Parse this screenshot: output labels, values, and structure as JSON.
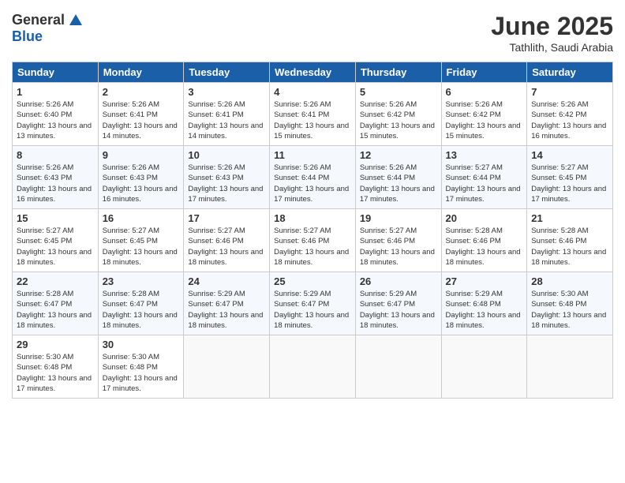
{
  "logo": {
    "general": "General",
    "blue": "Blue"
  },
  "title": "June 2025",
  "location": "Tathlith, Saudi Arabia",
  "weekdays": [
    "Sunday",
    "Monday",
    "Tuesday",
    "Wednesday",
    "Thursday",
    "Friday",
    "Saturday"
  ],
  "weeks": [
    [
      {
        "day": "1",
        "sunrise": "5:26 AM",
        "sunset": "6:40 PM",
        "daylight": "13 hours and 13 minutes."
      },
      {
        "day": "2",
        "sunrise": "5:26 AM",
        "sunset": "6:41 PM",
        "daylight": "13 hours and 14 minutes."
      },
      {
        "day": "3",
        "sunrise": "5:26 AM",
        "sunset": "6:41 PM",
        "daylight": "13 hours and 14 minutes."
      },
      {
        "day": "4",
        "sunrise": "5:26 AM",
        "sunset": "6:41 PM",
        "daylight": "13 hours and 15 minutes."
      },
      {
        "day": "5",
        "sunrise": "5:26 AM",
        "sunset": "6:42 PM",
        "daylight": "13 hours and 15 minutes."
      },
      {
        "day": "6",
        "sunrise": "5:26 AM",
        "sunset": "6:42 PM",
        "daylight": "13 hours and 15 minutes."
      },
      {
        "day": "7",
        "sunrise": "5:26 AM",
        "sunset": "6:42 PM",
        "daylight": "13 hours and 16 minutes."
      }
    ],
    [
      {
        "day": "8",
        "sunrise": "5:26 AM",
        "sunset": "6:43 PM",
        "daylight": "13 hours and 16 minutes."
      },
      {
        "day": "9",
        "sunrise": "5:26 AM",
        "sunset": "6:43 PM",
        "daylight": "13 hours and 16 minutes."
      },
      {
        "day": "10",
        "sunrise": "5:26 AM",
        "sunset": "6:43 PM",
        "daylight": "13 hours and 17 minutes."
      },
      {
        "day": "11",
        "sunrise": "5:26 AM",
        "sunset": "6:44 PM",
        "daylight": "13 hours and 17 minutes."
      },
      {
        "day": "12",
        "sunrise": "5:26 AM",
        "sunset": "6:44 PM",
        "daylight": "13 hours and 17 minutes."
      },
      {
        "day": "13",
        "sunrise": "5:27 AM",
        "sunset": "6:44 PM",
        "daylight": "13 hours and 17 minutes."
      },
      {
        "day": "14",
        "sunrise": "5:27 AM",
        "sunset": "6:45 PM",
        "daylight": "13 hours and 17 minutes."
      }
    ],
    [
      {
        "day": "15",
        "sunrise": "5:27 AM",
        "sunset": "6:45 PM",
        "daylight": "13 hours and 18 minutes."
      },
      {
        "day": "16",
        "sunrise": "5:27 AM",
        "sunset": "6:45 PM",
        "daylight": "13 hours and 18 minutes."
      },
      {
        "day": "17",
        "sunrise": "5:27 AM",
        "sunset": "6:46 PM",
        "daylight": "13 hours and 18 minutes."
      },
      {
        "day": "18",
        "sunrise": "5:27 AM",
        "sunset": "6:46 PM",
        "daylight": "13 hours and 18 minutes."
      },
      {
        "day": "19",
        "sunrise": "5:27 AM",
        "sunset": "6:46 PM",
        "daylight": "13 hours and 18 minutes."
      },
      {
        "day": "20",
        "sunrise": "5:28 AM",
        "sunset": "6:46 PM",
        "daylight": "13 hours and 18 minutes."
      },
      {
        "day": "21",
        "sunrise": "5:28 AM",
        "sunset": "6:46 PM",
        "daylight": "13 hours and 18 minutes."
      }
    ],
    [
      {
        "day": "22",
        "sunrise": "5:28 AM",
        "sunset": "6:47 PM",
        "daylight": "13 hours and 18 minutes."
      },
      {
        "day": "23",
        "sunrise": "5:28 AM",
        "sunset": "6:47 PM",
        "daylight": "13 hours and 18 minutes."
      },
      {
        "day": "24",
        "sunrise": "5:29 AM",
        "sunset": "6:47 PM",
        "daylight": "13 hours and 18 minutes."
      },
      {
        "day": "25",
        "sunrise": "5:29 AM",
        "sunset": "6:47 PM",
        "daylight": "13 hours and 18 minutes."
      },
      {
        "day": "26",
        "sunrise": "5:29 AM",
        "sunset": "6:47 PM",
        "daylight": "13 hours and 18 minutes."
      },
      {
        "day": "27",
        "sunrise": "5:29 AM",
        "sunset": "6:48 PM",
        "daylight": "13 hours and 18 minutes."
      },
      {
        "day": "28",
        "sunrise": "5:30 AM",
        "sunset": "6:48 PM",
        "daylight": "13 hours and 18 minutes."
      }
    ],
    [
      {
        "day": "29",
        "sunrise": "5:30 AM",
        "sunset": "6:48 PM",
        "daylight": "13 hours and 17 minutes."
      },
      {
        "day": "30",
        "sunrise": "5:30 AM",
        "sunset": "6:48 PM",
        "daylight": "13 hours and 17 minutes."
      },
      null,
      null,
      null,
      null,
      null
    ]
  ],
  "labels": {
    "sunrise": "Sunrise:",
    "sunset": "Sunset:",
    "daylight": "Daylight:"
  }
}
